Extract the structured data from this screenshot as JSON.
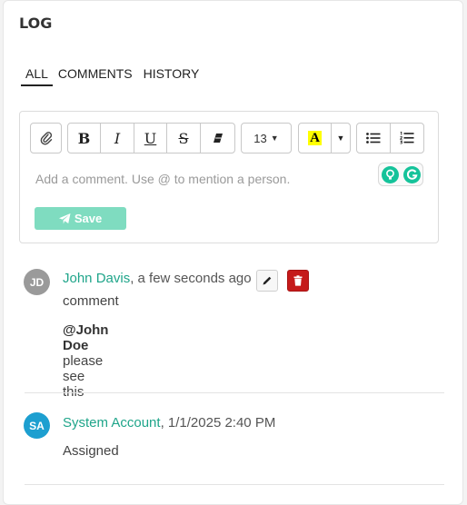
{
  "log": {
    "title": "LOG",
    "tabs": [
      {
        "label": "ALL",
        "active": true
      },
      {
        "label": "COMMENTS",
        "active": false
      },
      {
        "label": "HISTORY",
        "active": false
      }
    ]
  },
  "editor": {
    "toolbar": {
      "font_size": "13",
      "highlight_letter": "A",
      "icons": [
        "paperclip-icon",
        "bold-icon",
        "italic-icon",
        "underline-icon",
        "strikethrough-icon",
        "eraser-icon",
        "font-size-dropdown",
        "highlight-icon",
        "bulleted-list-icon",
        "numbered-list-icon"
      ]
    },
    "placeholder": "Add a comment. Use @ to mention a person.",
    "save_label": "Save",
    "save_color": "#7fdcc0"
  },
  "entries": [
    {
      "initials": "JD",
      "avatar_color": "#9a9a9a",
      "author": "John Davis",
      "time": ", a few seconds ago",
      "type": "comment",
      "mention": "@John Doe",
      "message": " please see this"
    },
    {
      "initials": "SA",
      "avatar_color": "#1d9fd0",
      "author": "System Account",
      "time": ", 1/1/2025 2:40 PM",
      "message": "Assigned"
    }
  ],
  "colors": {
    "author_link": "#1fa58a",
    "delete": "#c51a1a"
  }
}
